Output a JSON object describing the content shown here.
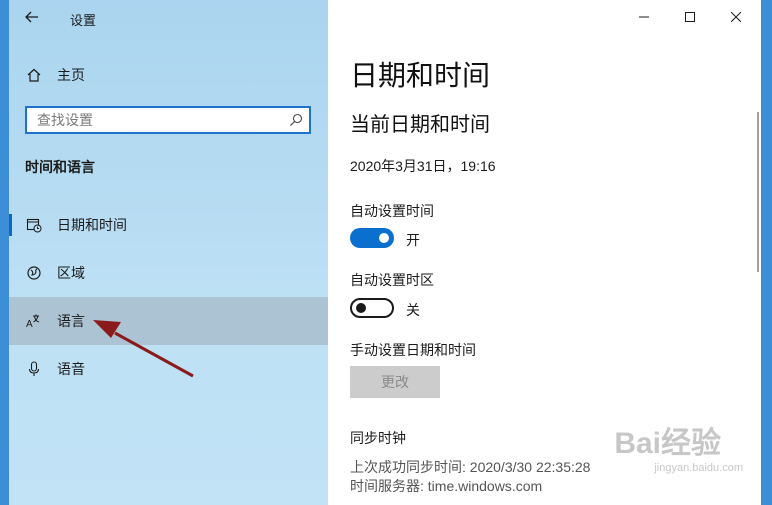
{
  "window": {
    "title": "设置"
  },
  "sidebar": {
    "home_label": "主页",
    "search": {
      "placeholder": "查找设置",
      "value": ""
    },
    "section_heading": "时间和语言",
    "items": [
      {
        "label": "日期和时间",
        "icon": "calendar-clock-icon"
      },
      {
        "label": "区域",
        "icon": "globe-icon"
      },
      {
        "label": "语言",
        "icon": "language-icon",
        "selected": true
      },
      {
        "label": "语音",
        "icon": "microphone-icon"
      }
    ]
  },
  "main": {
    "page_title": "日期和时间",
    "subtitle": "当前日期和时间",
    "current_datetime": "2020年3月31日，19:16",
    "auto_time": {
      "label": "自动设置时间",
      "state": "开",
      "on": true
    },
    "auto_timezone": {
      "label": "自动设置时区",
      "state": "关",
      "on": false
    },
    "manual": {
      "label": "手动设置日期和时间",
      "button": "更改"
    },
    "sync": {
      "heading": "同步时钟",
      "last_sync": "上次成功同步时间: 2020/3/30 22:35:28",
      "server": "时间服务器: time.windows.com"
    }
  },
  "watermark": {
    "brand": "Bai经验",
    "url": "jingyan.baidu.com"
  },
  "colors": {
    "accent": "#0b6fd0",
    "sidebar_bg": "#bde0f4",
    "arrow": "#8b1a1a"
  }
}
